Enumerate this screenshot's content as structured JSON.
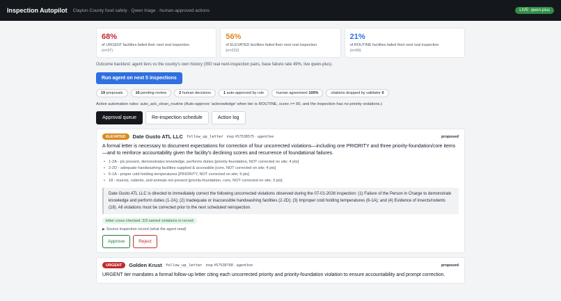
{
  "header": {
    "title": "Inspection Autopilot",
    "subtitle": "Clayton County food safety · Qwen triage · human-approved actions",
    "live_badge": "LIVE: qwen-plus"
  },
  "stats": [
    {
      "value": "68%",
      "label": "of URGENT facilities failed their next real inspection",
      "n": "(n=37)",
      "color": "#c2282e"
    },
    {
      "value": "56%",
      "label": "of ELEVATED facilities failed their next real inspection",
      "n": "(n=223)",
      "color": "#d98a1e"
    },
    {
      "value": "21%",
      "label": "of ROUTINE facilities failed their next real inspection",
      "n": "(n=90)",
      "color": "#2f6fe0"
    }
  ],
  "backtest_note": "Outcome backtest: agent tiers vs the county's own history (350 real next-inspection pairs, base failure rate 49%, live qwen-plus).",
  "run_button": "Run agent on next 5 inspections",
  "pills": [
    {
      "num": "19",
      "text": " proposals"
    },
    {
      "num": "16",
      "text": " pending review"
    },
    {
      "num": "2",
      "text": " human decisions"
    },
    {
      "num": "1",
      "text": " auto-approved by rule"
    },
    {
      "text": "human agreement ",
      "num": "100%"
    },
    {
      "text": "citations dropped by validator ",
      "num": "0"
    }
  ],
  "rules_note": "Active automation rules: auto_ack_clean_routine (Auto-approve 'acknowledge' when tier is ROUTINE, score >= 90, and the inspection has no priority violations.)",
  "tabs": [
    "Approval queue",
    "Re-inspection schedule",
    "Action log"
  ],
  "cards": [
    {
      "tier": "ELEVATED",
      "facility": "Date Gusto ATL LLC",
      "action": "follow_up_letter",
      "meta": "insp #57538575 · agent:live",
      "status": "proposed",
      "summary": "A formal letter is necessary to document expectations for correction of four uncorrected violations—including one PRIORITY and three priority-foundation/core items—and to reinforce accountability given the facility's declining scores and recurrence of foundational failures.",
      "violations": [
        "1-2A - pic present, demonstrates knowledge, performs duties [priority-foundation, NOT corrected on site; 4 pts]",
        "2-2D - adequate handwashing facilities supplied & accessible [core, NOT corrected on site; 4 pts]",
        "6-1A - proper cold holding temperatures [PRIORITY, NOT corrected on site; 9 pts]",
        "18 - insects, rodents, and animals not present [priority-foundation, core, NOT corrected on site; 3 pts]"
      ],
      "letter": "Date Gusto ATL LLC is directed to immediately correct the following uncorrected violations observed during the 07-01-2026 inspection: (1) Failure of the Person in Charge to demonstrate knowledge and perform duties (1-2A); (2) Inadequate or inaccessible handwashing facilities (2-2D); (3) Improper cold holding temperatures (6-1A); and (4) Evidence of insects/rodents (18). All violations must be corrected prior to the next scheduled reinspection.",
      "verify": "letter cross-checked: 3/3 named violations in record",
      "source": "Source inspection record (what the agent read)",
      "approve": "Approve",
      "reject": "Reject"
    },
    {
      "tier": "URGENT",
      "facility": "Golden Krust",
      "action": "follow_up_letter",
      "meta": "insp #57538788 · agent:live",
      "status": "proposed",
      "summary": "URGENT tier mandates a formal follow-up letter citing each uncorrected priority and priority-foundation violation to ensure accountability and prompt correction."
    }
  ]
}
